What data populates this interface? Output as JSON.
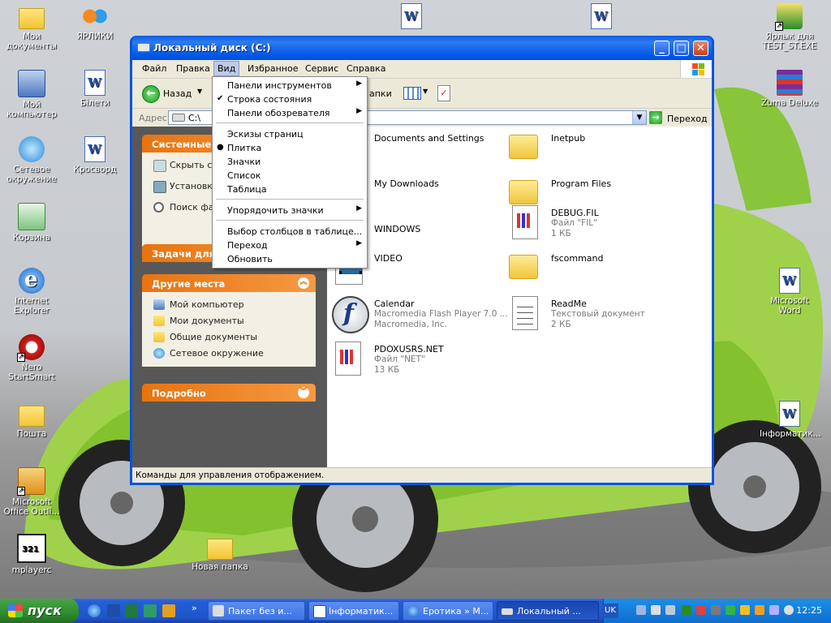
{
  "desktop": {
    "icons_left": [
      {
        "name": "my-documents-icon",
        "label": "Мои документы",
        "kind": "folder"
      },
      {
        "name": "shortcuts-icon",
        "label": "ЯРЛИКИ",
        "kind": "butterfly"
      },
      {
        "name": "my-computer-icon",
        "label": "Мой компьютер",
        "kind": "pc"
      },
      {
        "name": "bileti-icon",
        "label": "Білети",
        "kind": "word"
      },
      {
        "name": "network-icon",
        "label": "Сетевое окружение",
        "kind": "globe"
      },
      {
        "name": "crossword-icon",
        "label": "Кросворд",
        "kind": "word"
      },
      {
        "name": "recycle-bin-icon",
        "label": "Корзина",
        "kind": "bin"
      },
      {
        "name": "ie-icon",
        "label": "Internet Explorer",
        "kind": "ie"
      },
      {
        "name": "nero-icon",
        "label": "Nero StartSmart",
        "kind": "nero"
      },
      {
        "name": "pochta-icon",
        "label": "Пошта",
        "kind": "folder"
      },
      {
        "name": "outlook-icon",
        "label": "Microsoft Office Outli...",
        "kind": "outlook"
      },
      {
        "name": "mplayerc-icon",
        "label": "mplayerc",
        "kind": "clap"
      },
      {
        "name": "new-folder-icon",
        "label": "Новая папка",
        "kind": "folder"
      }
    ],
    "icons_right": [
      {
        "name": "test-st-exe-icon",
        "label": "Ярлык для TEST_ST.EXE",
        "kind": "exe"
      },
      {
        "name": "zuma-icon",
        "label": "Zuma Deluxe",
        "kind": "rar"
      },
      {
        "name": "ms-word-icon",
        "label": "Microsoft Word",
        "kind": "word"
      },
      {
        "name": "informatik-icon",
        "label": "Інформатик...",
        "kind": "word"
      }
    ]
  },
  "window": {
    "title": "Локальный диск (C:)",
    "menu": [
      "Файл",
      "Правка",
      "Вид",
      "Избранное",
      "Сервис",
      "Справка"
    ],
    "toolbar": {
      "back_label": "Назад",
      "folders_partial": "апки"
    },
    "address": {
      "label": "Адрес:",
      "value": "C:\\",
      "go_label": "Переход"
    },
    "status": "Команды для управления отображением."
  },
  "left_panel": {
    "system_tasks": {
      "title": "Системные з",
      "links": [
        "Скрыть с устройств",
        "Установк программ",
        "Поиск фа"
      ]
    },
    "file_tasks": {
      "title": "Задачи для"
    },
    "other_places": {
      "title": "Другие места",
      "links": [
        "Мой компьютер",
        "Мои документы",
        "Общие документы",
        "Сетевое окружение"
      ]
    },
    "details": {
      "title": "Подробно"
    }
  },
  "files": [
    {
      "name": "Documents and Settings",
      "line2": "",
      "line3": "",
      "icon": "folder"
    },
    {
      "name": "Inetpub",
      "line2": "",
      "line3": "",
      "icon": "folder"
    },
    {
      "name": "My Downloads",
      "line2": "",
      "line3": "",
      "icon": "folder"
    },
    {
      "name": "Program Files",
      "line2": "",
      "line3": "",
      "icon": "folder"
    },
    {
      "name": "WINDOWS",
      "line2": "",
      "line3": "",
      "icon": "folder"
    },
    {
      "name": "DEBUG.FIL",
      "line2": "Файл \"FIL\"",
      "line3": "1 КБ",
      "icon": "doc"
    },
    {
      "name": "VIDEO",
      "line2": "",
      "line3": "",
      "icon": "video"
    },
    {
      "name": "fscommand",
      "line2": "",
      "line3": "",
      "icon": "folder"
    },
    {
      "name": "Calendar",
      "line2": "Macromedia Flash Player 7.0 ...",
      "line3": "Macromedia, Inc.",
      "icon": "flash"
    },
    {
      "name": "ReadMe",
      "line2": "Текстовый документ",
      "line3": "2 КБ",
      "icon": "text"
    },
    {
      "name": "PDOXUSRS.NET",
      "line2": "Файл \"NET\"",
      "line3": "13 КБ",
      "icon": "doc"
    }
  ],
  "view_menu": {
    "items": [
      {
        "label": "Панели инструментов",
        "submenu": true,
        "mark": ""
      },
      {
        "label": "Строка состояния",
        "submenu": false,
        "mark": "✔"
      },
      {
        "label": "Панели обозревателя",
        "submenu": true,
        "mark": ""
      },
      {
        "label": "Эскизы страниц",
        "submenu": false,
        "mark": ""
      },
      {
        "label": "Плитка",
        "submenu": false,
        "mark": "●"
      },
      {
        "label": "Значки",
        "submenu": false,
        "mark": ""
      },
      {
        "label": "Список",
        "submenu": false,
        "mark": ""
      },
      {
        "label": "Таблица",
        "submenu": false,
        "mark": ""
      },
      {
        "label": "Упорядочить значки",
        "submenu": true,
        "mark": ""
      },
      {
        "label": "Выбор столбцов в таблице...",
        "submenu": false,
        "mark": ""
      },
      {
        "label": "Переход",
        "submenu": true,
        "mark": ""
      },
      {
        "label": "Обновить",
        "submenu": false,
        "mark": ""
      }
    ]
  },
  "taskbar": {
    "start_label": "пуск",
    "tasks": [
      {
        "label": "Пакет без и...",
        "active": false
      },
      {
        "label": "Інформатик...",
        "active": false
      },
      {
        "label": "Еротика » М...",
        "active": false
      },
      {
        "label": "Локальный ...",
        "active": true
      }
    ],
    "lang": "UK",
    "clock": "12:25"
  }
}
